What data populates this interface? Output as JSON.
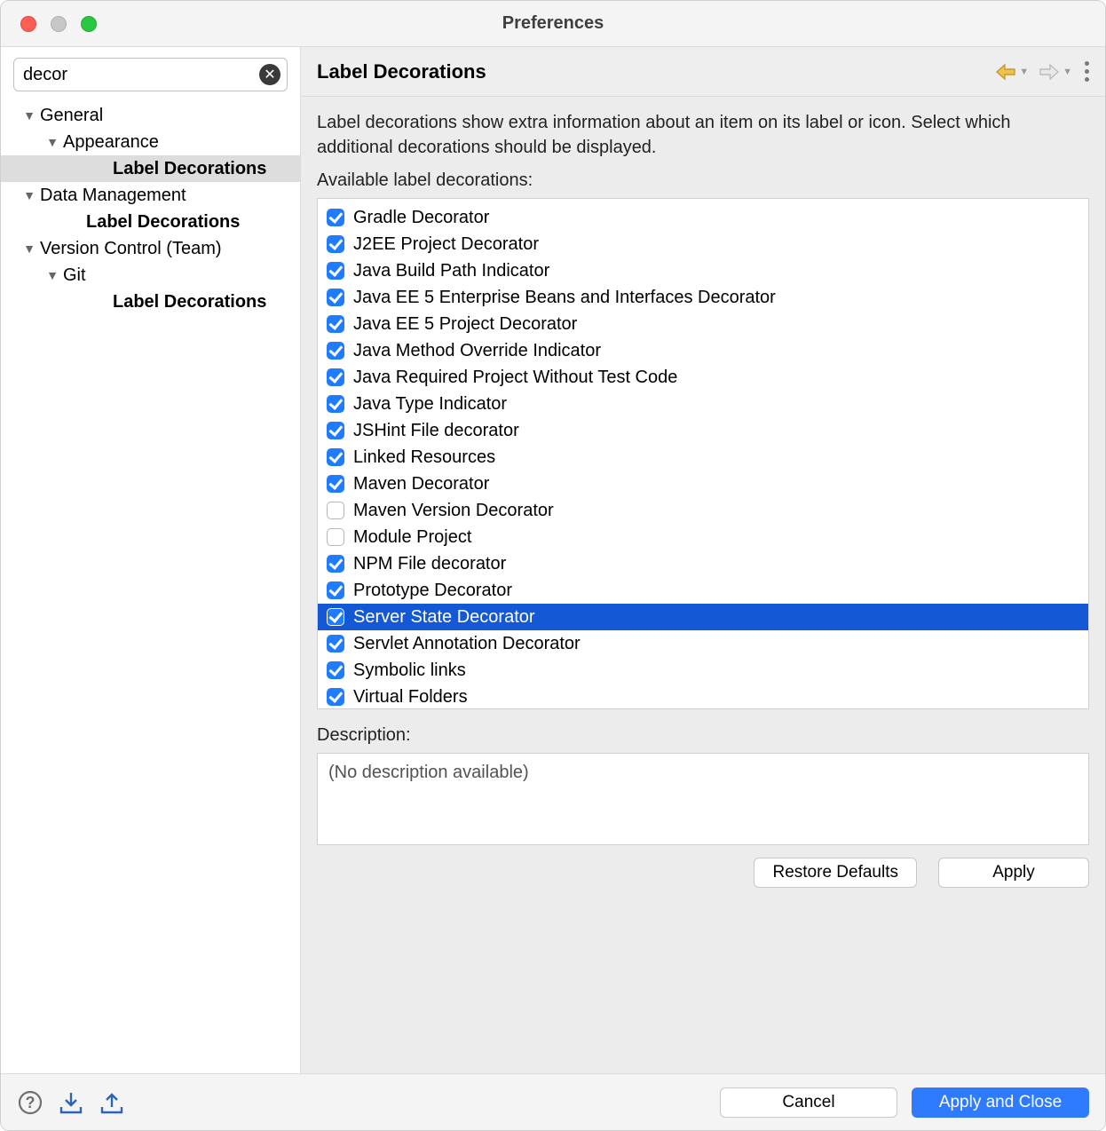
{
  "window": {
    "title": "Preferences"
  },
  "search": {
    "value": "decor"
  },
  "tree": {
    "nodes": [
      {
        "label": "General",
        "indent": 1,
        "twisty": "▼",
        "bold": false,
        "selected": false
      },
      {
        "label": "Appearance",
        "indent": 2,
        "twisty": "▼",
        "bold": false,
        "selected": false
      },
      {
        "label": "Label Decorations",
        "indent": 4,
        "twisty": "",
        "bold": true,
        "selected": true
      },
      {
        "label": "Data Management",
        "indent": 1,
        "twisty": "▼",
        "bold": false,
        "selected": false
      },
      {
        "label": "Label Decorations",
        "indent": 3,
        "twisty": "",
        "bold": true,
        "selected": false
      },
      {
        "label": "Version Control (Team)",
        "indent": 1,
        "twisty": "▼",
        "bold": false,
        "selected": false
      },
      {
        "label": "Git",
        "indent": 2,
        "twisty": "▼",
        "bold": false,
        "selected": false
      },
      {
        "label": "Label Decorations",
        "indent": 4,
        "twisty": "",
        "bold": true,
        "selected": false
      }
    ]
  },
  "page": {
    "title": "Label Decorations",
    "intro": "Label decorations show extra information about an item on its label or icon. Select which additional decorations should be displayed.",
    "available_label": "Available label decorations:",
    "description_label": "Description:",
    "description_value": "(No description available)"
  },
  "decorations": [
    {
      "label": "Gradle Decorator",
      "checked": true,
      "selected": false
    },
    {
      "label": "J2EE Project Decorator",
      "checked": true,
      "selected": false
    },
    {
      "label": "Java Build Path Indicator",
      "checked": true,
      "selected": false
    },
    {
      "label": "Java EE 5 Enterprise Beans and Interfaces Decorator",
      "checked": true,
      "selected": false
    },
    {
      "label": "Java EE 5 Project Decorator",
      "checked": true,
      "selected": false
    },
    {
      "label": "Java Method Override Indicator",
      "checked": true,
      "selected": false
    },
    {
      "label": "Java Required Project Without Test Code",
      "checked": true,
      "selected": false
    },
    {
      "label": "Java Type Indicator",
      "checked": true,
      "selected": false
    },
    {
      "label": "JSHint File decorator",
      "checked": true,
      "selected": false
    },
    {
      "label": "Linked Resources",
      "checked": true,
      "selected": false
    },
    {
      "label": "Maven Decorator",
      "checked": true,
      "selected": false
    },
    {
      "label": "Maven Version Decorator",
      "checked": false,
      "selected": false
    },
    {
      "label": "Module Project",
      "checked": false,
      "selected": false
    },
    {
      "label": "NPM File decorator",
      "checked": true,
      "selected": false
    },
    {
      "label": "Prototype Decorator",
      "checked": true,
      "selected": false
    },
    {
      "label": "Server State Decorator",
      "checked": true,
      "selected": true
    },
    {
      "label": "Servlet Annotation Decorator",
      "checked": true,
      "selected": false
    },
    {
      "label": "Symbolic links",
      "checked": true,
      "selected": false
    },
    {
      "label": "Virtual Folders",
      "checked": true,
      "selected": false
    }
  ],
  "buttons": {
    "restore_defaults": "Restore Defaults",
    "apply": "Apply",
    "cancel": "Cancel",
    "apply_close": "Apply and Close"
  }
}
